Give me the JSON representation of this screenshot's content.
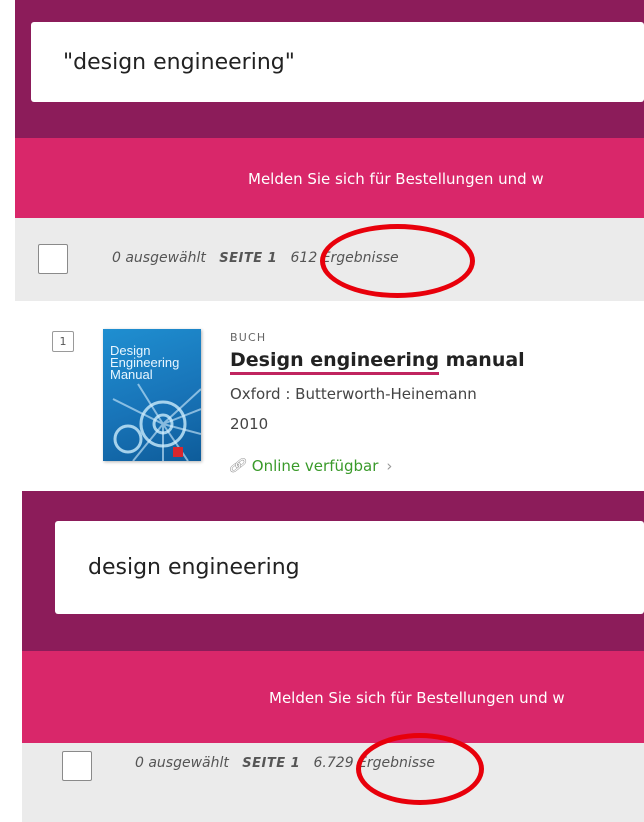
{
  "panel_top": {
    "search_value": "\"design engineering\"",
    "banner_text": "Melden Sie sich für Bestellungen und w",
    "selected_label": "0 ausgewählt",
    "page_label": "SEITE 1",
    "results_label": "612 Ergebnisse",
    "result": {
      "number": "1",
      "type": "BUCH",
      "title_highlight": "Design engineering",
      "title_rest": " manual",
      "publisher": "Oxford : Butterworth-Heinemann",
      "year": "2010",
      "availability": "Online verfügbar",
      "cover_title": "Design\nEngineering\nManual"
    }
  },
  "panel_bottom": {
    "search_value": "design engineering",
    "banner_text": "Melden Sie sich für Bestellungen und w",
    "selected_label": "0 ausgewählt",
    "page_label": "SEITE 1",
    "results_label": "6.729 Ergebnisse"
  },
  "colors": {
    "header_purple": "#8c1c5a",
    "banner_pink": "#d9276a",
    "annotation_red": "#e8000b",
    "available_green": "#3a9a2a"
  }
}
